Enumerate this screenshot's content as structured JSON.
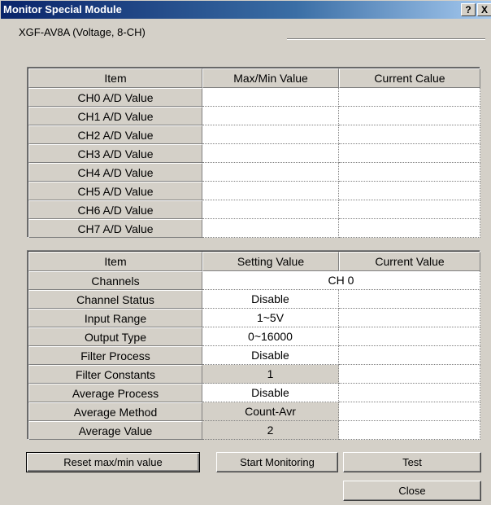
{
  "window": {
    "title": "Monitor Special Module",
    "help_label": "?",
    "close_label": "X"
  },
  "module_label": "XGF-AV8A (Voltage, 8-CH)",
  "table1": {
    "headers": [
      "Item",
      "Max/Min Value",
      "Current Calue"
    ],
    "rows": [
      {
        "label": "CH0 A/D Value",
        "max_min": "",
        "current": ""
      },
      {
        "label": "CH1 A/D Value",
        "max_min": "",
        "current": ""
      },
      {
        "label": "CH2 A/D Value",
        "max_min": "",
        "current": ""
      },
      {
        "label": "CH3 A/D Value",
        "max_min": "",
        "current": ""
      },
      {
        "label": "CH4 A/D Value",
        "max_min": "",
        "current": ""
      },
      {
        "label": "CH5 A/D Value",
        "max_min": "",
        "current": ""
      },
      {
        "label": "CH6 A/D Value",
        "max_min": "",
        "current": ""
      },
      {
        "label": "CH7 A/D Value",
        "max_min": "",
        "current": ""
      }
    ]
  },
  "table2": {
    "headers": [
      "Item",
      "Setting Value",
      "Current Value"
    ],
    "channels": {
      "label": "Channels",
      "value": "CH 0"
    },
    "rows": [
      {
        "label": "Channel Status",
        "setting": "Disable",
        "current": ""
      },
      {
        "label": "Input Range",
        "setting": "1~5V",
        "current": ""
      },
      {
        "label": "Output Type",
        "setting": "0~16000",
        "current": ""
      },
      {
        "label": "Filter Process",
        "setting": "Disable",
        "current": ""
      },
      {
        "label": "Filter Constants",
        "setting": "1",
        "current": ""
      },
      {
        "label": "Average Process",
        "setting": "Disable",
        "current": ""
      },
      {
        "label": "Average Method",
        "setting": "Count-Avr",
        "current": ""
      },
      {
        "label": "Average Value",
        "setting": "2",
        "current": ""
      }
    ]
  },
  "buttons": {
    "reset": "Reset max/min value",
    "start": "Start Monitoring",
    "test": "Test",
    "close": "Close"
  }
}
